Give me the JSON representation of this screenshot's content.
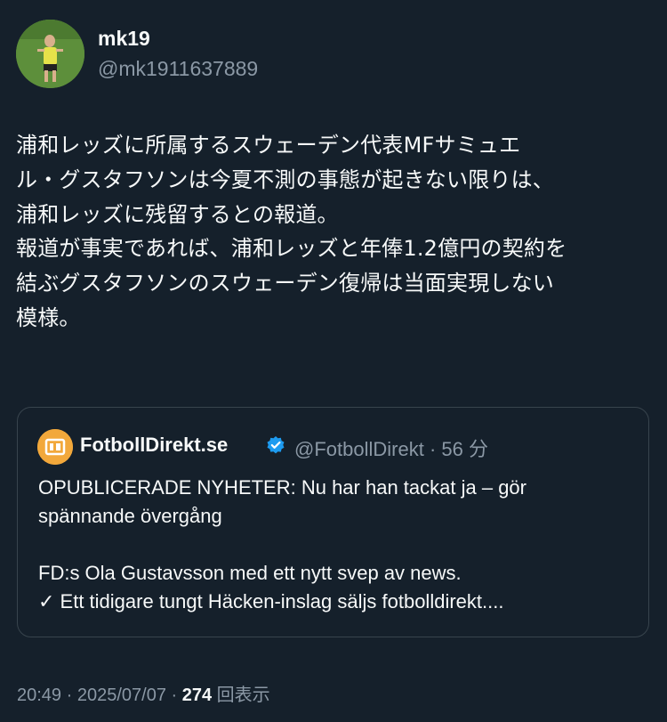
{
  "author": {
    "name": "mk19",
    "handle": "@mk1911637889"
  },
  "tweet": {
    "text": "浦和レッズに所属するスウェーデン代表MFサミュエ\nル・グスタフソンは今夏不測の事態が起きない限りは、\n浦和レッズに残留するとの報道。\n報道が事実であれば、浦和レッズと年俸1.2億円の契約を\n結ぶグスタフソンのスウェーデン復帰は当面実現しない\n模様。"
  },
  "quote": {
    "name": "FotbollDirekt.se",
    "handle": "@FotbollDirekt",
    "time": "56 分",
    "text": "OPUBLICERADE NYHETER: Nu har han tackat ja – gör\nspännande övergång\n\nFD:s Ola Gustavsson med ett nytt svep av news.\n✓ Ett tidigare tungt Häcken-inslag säljs fotbolldirekt...."
  },
  "footer": {
    "time": "20:49",
    "date": "2025/07/07",
    "views": "274",
    "views_label": "回表示",
    "separator": "·"
  },
  "colors": {
    "background": "#15202b",
    "verified": "#1d9bf0",
    "quote_brand": "#f2a83b",
    "muted_text": "#8b98a5"
  },
  "icons": {
    "verified": "verified-badge-icon",
    "quote_logo": "fotbolldirekt-logo-icon"
  }
}
